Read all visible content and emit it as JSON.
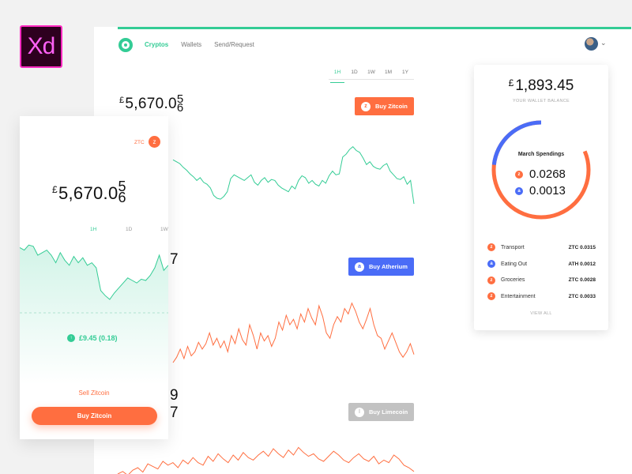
{
  "badge": {
    "text": "Xd"
  },
  "desktop": {
    "nav": [
      "Cryptos",
      "Wallets",
      "Send/Request"
    ],
    "active_nav": "Cryptos",
    "timeframes": [
      "1H",
      "1D",
      "1W",
      "1M",
      "1Y"
    ],
    "active_timeframe": "1H",
    "main_price": {
      "currency": "£",
      "value": "5,670.0",
      "rolling_digits": "5\n6"
    },
    "partial_digits": [
      "7",
      "9",
      "7"
    ],
    "buttons": {
      "zitcoin": "Buy Zitcoin",
      "atherium": "Buy Atherium",
      "limecoin": "Buy Limecoin"
    },
    "colors": {
      "accent": "#33cc95",
      "ztc": "#ff6e40",
      "ath": "#4a6cf7",
      "lime": "#c2c2c2"
    }
  },
  "wallet": {
    "currency": "£",
    "balance": "1,893.45",
    "caption": "YOUR WALLET BALANCE",
    "ring_title": "March Spendings",
    "ring_ztc": "0.0268",
    "ring_ath": "0.0013",
    "spendings": [
      {
        "coin": "ztc",
        "category": "Transport",
        "amount": "ZTC 0.0315"
      },
      {
        "coin": "ath",
        "category": "Eating Out",
        "amount": "ATH 0.0012"
      },
      {
        "coin": "ztc",
        "category": "Groceries",
        "amount": "ZTC 0.0028"
      },
      {
        "coin": "ztc",
        "category": "Entertainment",
        "amount": "ZTC 0.0033"
      }
    ],
    "view_all": "VIEW ALL"
  },
  "mobile": {
    "ticker": "ZTC",
    "price": {
      "currency": "£",
      "value": "5,670.0",
      "rolling_digits": "5\n6"
    },
    "timeframes": [
      "1H",
      "1D",
      "1W"
    ],
    "change": "£9.45 (0.18)",
    "sell_label": "Sell Zitcoin",
    "buy_label": "Buy Zitcoin"
  },
  "chart_data": [
    {
      "type": "line",
      "name": "Zitcoin",
      "values": [
        52,
        50,
        48,
        44,
        41,
        37,
        34,
        30,
        33,
        28,
        26,
        22,
        14,
        11,
        10,
        13,
        18,
        32,
        36,
        34,
        32,
        30,
        33,
        36,
        28,
        25,
        30,
        33,
        28,
        31,
        30,
        25,
        22,
        20,
        18,
        24,
        21,
        30,
        35,
        33,
        27,
        30,
        26,
        24,
        30,
        27,
        35,
        40,
        36,
        37,
        55,
        58,
        63,
        66,
        62,
        60,
        54,
        47,
        50,
        45,
        43,
        42,
        46,
        48,
        40,
        36,
        32,
        31,
        34,
        26,
        30,
        5
      ],
      "color": "#33cc95"
    },
    {
      "type": "line",
      "name": "Atherium",
      "values": [
        30,
        34,
        40,
        33,
        42,
        35,
        38,
        45,
        40,
        44,
        52,
        43,
        48,
        41,
        46,
        38,
        50,
        44,
        55,
        47,
        43,
        58,
        50,
        40,
        52,
        46,
        50,
        42,
        48,
        60,
        54,
        65,
        58,
        62,
        55,
        66,
        60,
        70,
        63,
        58,
        72,
        64,
        52,
        48,
        58,
        64,
        60,
        70,
        66,
        74,
        68,
        60,
        55,
        62,
        70,
        58,
        50,
        48,
        40,
        46,
        52,
        45,
        38,
        34,
        38,
        44,
        36
      ],
      "color": "#ff6e40"
    },
    {
      "type": "line",
      "name": "Limecoin",
      "values": [
        30,
        34,
        28,
        36,
        40,
        33,
        46,
        42,
        38,
        50,
        44,
        48,
        40,
        52,
        46,
        56,
        48,
        44,
        58,
        50,
        62,
        54,
        48,
        60,
        52,
        64,
        56,
        52,
        60,
        66,
        58,
        70,
        62,
        56,
        68,
        60,
        72,
        64,
        58,
        62,
        54,
        50,
        58,
        66,
        60,
        52,
        48,
        56,
        62,
        54,
        50,
        58,
        46,
        52,
        48,
        60,
        54,
        44,
        40,
        34
      ],
      "color": "#ff6e40"
    },
    {
      "type": "line",
      "name": "Mobile Zitcoin",
      "values": [
        56,
        54,
        58,
        57,
        50,
        52,
        54,
        50,
        44,
        52,
        46,
        42,
        49,
        44,
        48,
        42,
        44,
        40,
        22,
        18,
        15,
        20,
        24,
        28,
        32,
        30,
        28,
        31,
        30,
        34,
        40,
        50,
        38,
        42
      ],
      "color": "#33cc95"
    }
  ]
}
